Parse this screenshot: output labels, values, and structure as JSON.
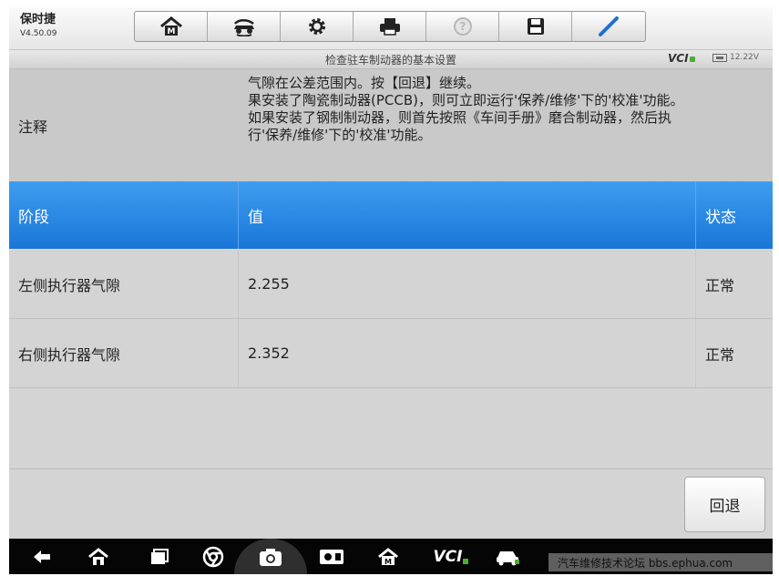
{
  "app": {
    "name": "保时捷",
    "version": "V4.50.09"
  },
  "toolbar": {
    "buttons": [
      {
        "icon": "home-icon"
      },
      {
        "icon": "car-lift-icon"
      },
      {
        "icon": "gear-icon"
      },
      {
        "icon": "printer-icon"
      },
      {
        "icon": "help-icon"
      },
      {
        "icon": "save-icon"
      },
      {
        "icon": "pen-icon"
      }
    ]
  },
  "subbar": {
    "title": "检查驻车制动器的基本设置",
    "vci": "VCI",
    "voltage": "12.22V"
  },
  "table": {
    "note_label": "注释",
    "note_text": [
      "气隙在公差范围内。按【回退】继续。",
      "果安装了陶瓷制动器(PCCB)，则可立即运行'保养/维修'下的'校准'功能。",
      "如果安装了钢制制动器，则首先按照《车间手册》磨合制动器，然后执行'保养/维修'下的'校准'功能。"
    ],
    "headers": [
      "阶段",
      "值",
      "状态"
    ],
    "rows": [
      {
        "stage": "左侧执行器气隙",
        "value": "2.255",
        "status": "正常"
      },
      {
        "stage": "右侧执行器气隙",
        "value": "2.352",
        "status": "正常"
      }
    ]
  },
  "actions": {
    "back_label": "回退"
  },
  "navbar": {
    "vci_label": "VCI",
    "watermark": "汽车维修技术论坛 bbs.ephua.com"
  },
  "colors": {
    "header_blue": "#2a86e2",
    "panel_gray": "#d4d4d4",
    "accent_green": "#4caf32"
  }
}
